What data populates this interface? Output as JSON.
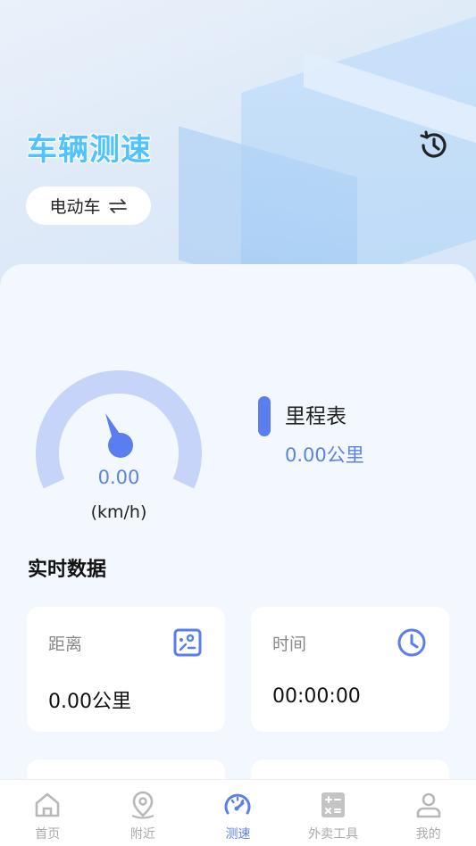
{
  "header": {
    "title": "车辆测速"
  },
  "vehicle_selector": {
    "label": "电动车",
    "icon": "swap-icon"
  },
  "speedometer": {
    "value": "0.00",
    "unit": "(km/h)"
  },
  "odometer": {
    "label": "里程表",
    "value": "0.00公里"
  },
  "realtime": {
    "title": "实时数据",
    "tiles": [
      {
        "label": "距离",
        "value": "0.00公里",
        "icon": "map-icon"
      },
      {
        "label": "时间",
        "value": "00:00:00",
        "icon": "clock-icon"
      }
    ]
  },
  "tabbar": {
    "items": [
      {
        "label": "首页",
        "icon": "home-icon",
        "active": false
      },
      {
        "label": "附近",
        "icon": "location-pin-icon",
        "active": false
      },
      {
        "label": "测速",
        "icon": "speedometer-icon",
        "active": true
      },
      {
        "label": "外卖工具",
        "icon": "calculator-icon",
        "active": false
      },
      {
        "label": "我的",
        "icon": "user-icon",
        "active": false
      }
    ]
  },
  "colors": {
    "accent": "#5c82e4",
    "title": "#4fc3ff",
    "gauge_track": "#c7d4f9"
  }
}
